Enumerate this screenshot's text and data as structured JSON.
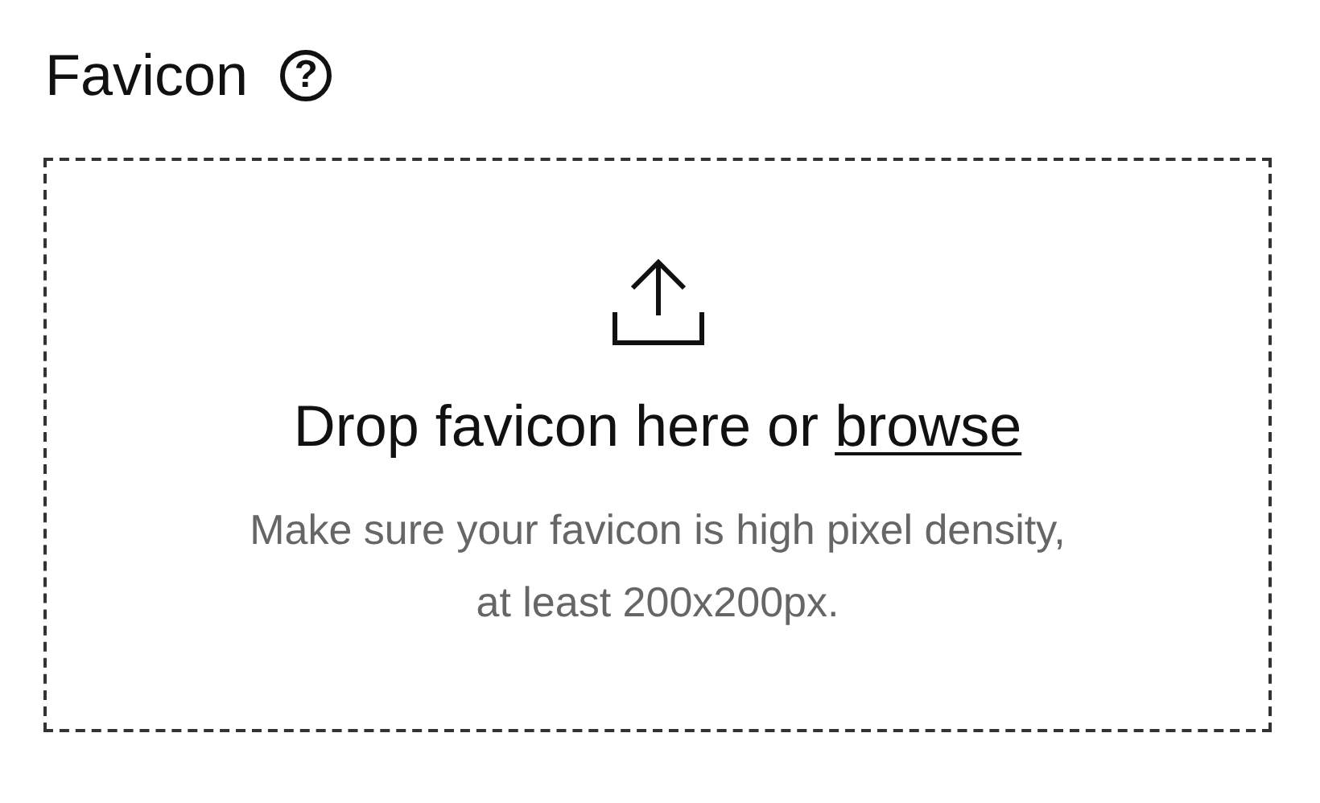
{
  "title": "Favicon",
  "help": "?",
  "dropzone": {
    "prompt": "Drop favicon here or",
    "link": "browse",
    "hint": "Make sure your favicon is high pixel density, at least 200x200px."
  }
}
